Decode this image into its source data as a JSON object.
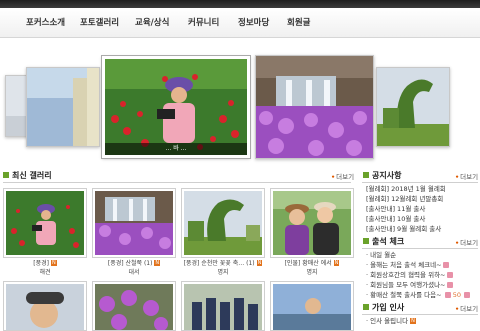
{
  "nav": {
    "items": [
      "포커스소개",
      "포토갤러리",
      "교육/상식",
      "커뮤니티",
      "정보마당",
      "회원글"
    ]
  },
  "carousel": {
    "caption": "... 바 ..."
  },
  "gallery": {
    "title": "최신 갤러리",
    "more": "더보기",
    "items": [
      {
        "line1": "[풍경]",
        "line2": "해견"
      },
      {
        "line1": "[풍경] 산철쭉 (1)",
        "line2": "대서"
      },
      {
        "line1": "[풍경] 순천만 꽃꽃 축… (1)",
        "line2": "명지"
      },
      {
        "line1": "[인물] 황매산 에서",
        "line2": "명지"
      }
    ]
  },
  "notice": {
    "title": "공지사항",
    "more": "더보기",
    "items": [
      "[월례회] 2018년 1월 월례회",
      "[월례회] 12월례회 년말총회",
      "[출사안내] 11월 출사",
      "[출사안내] 10월 출사",
      "[출사안내] 9월 월례회 출사"
    ]
  },
  "attendance": {
    "title": "출석 체크",
    "more": "더보기",
    "items": [
      {
        "text": "· 내일 월순"
      },
      {
        "text": "· 올해는 처음 출석 체크네~"
      },
      {
        "text": "· 회원상호간의 협력을 위하~"
      },
      {
        "text": "· 회원님들 모두 여행가셨나~"
      },
      {
        "text": "· 황매산 철쭉 출사를 다음~",
        "count": "50"
      }
    ]
  },
  "join": {
    "title": "가입 인사",
    "more": "더보기",
    "items": [
      {
        "text": "· 인사 올립니다"
      }
    ]
  },
  "colors": {
    "accent_green": "#6aa22a",
    "new_badge": "#e2731c",
    "topbar": "#2a2a2a"
  }
}
